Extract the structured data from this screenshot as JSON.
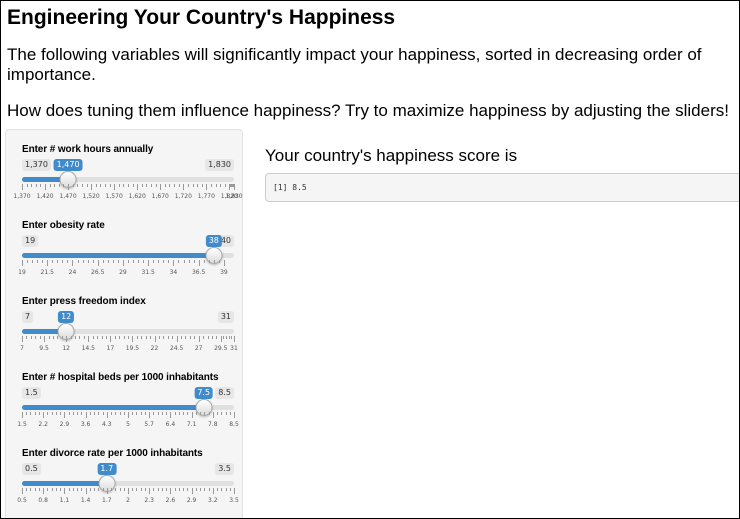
{
  "header": {
    "title": "Engineering Your Country's Happiness",
    "intro": "The following variables will significantly impact your happiness, sorted in decreasing order of importance.",
    "question": "How does tuning them influence happiness? Try to maximize happiness by adjusting the sliders!"
  },
  "sliders": [
    {
      "label": "Enter # work hours annually",
      "min": 1370,
      "max": 1830,
      "value": 1470,
      "min_label": "1,370",
      "max_label": "1,830",
      "value_label": "1,470",
      "ticks": [
        1370,
        1420,
        1470,
        1520,
        1570,
        1620,
        1670,
        1720,
        1770,
        1820,
        1830
      ],
      "tick_labels": [
        "1,370",
        "1,420",
        "1,470",
        "1,520",
        "1,570",
        "1,620",
        "1,670",
        "1,720",
        "1,770",
        "1,820",
        "1,830"
      ]
    },
    {
      "label": "Enter obesity rate",
      "min": 19,
      "max": 40,
      "value": 38,
      "min_label": "19",
      "max_label": "40",
      "value_label": "38",
      "ticks": [
        19,
        21.5,
        24,
        26.5,
        29,
        31.5,
        34,
        36.5,
        39
      ],
      "tick_labels": [
        "19",
        "21.5",
        "24",
        "26.5",
        "29",
        "31.5",
        "34",
        "36.5",
        "39"
      ]
    },
    {
      "label": "Enter press freedom index",
      "min": 7,
      "max": 31,
      "value": 12,
      "min_label": "7",
      "max_label": "31",
      "value_label": "12",
      "ticks": [
        7,
        9.5,
        12,
        14.5,
        17,
        19.5,
        22,
        24.5,
        27,
        29.5,
        31
      ],
      "tick_labels": [
        "7",
        "9.5",
        "12",
        "14.5",
        "17",
        "19.5",
        "22",
        "24.5",
        "27",
        "29.5",
        "31"
      ]
    },
    {
      "label": "Enter # hospital beds per 1000 inhabitants",
      "min": 1.5,
      "max": 8.5,
      "value": 7.5,
      "min_label": "1.5",
      "max_label": "8.5",
      "value_label": "7.5",
      "ticks": [
        1.5,
        2.2,
        2.9,
        3.6,
        4.3,
        5,
        5.7,
        6.4,
        7.1,
        7.8,
        8.5
      ],
      "tick_labels": [
        "1.5",
        "2.2",
        "2.9",
        "3.6",
        "4.3",
        "5",
        "5.7",
        "6.4",
        "7.1",
        "7.8",
        "8.5"
      ]
    },
    {
      "label": "Enter divorce rate per 1000 inhabitants",
      "min": 0.5,
      "max": 3.5,
      "value": 1.7,
      "min_label": "0.5",
      "max_label": "3.5",
      "value_label": "1.7",
      "ticks": [
        0.5,
        0.8,
        1.1,
        1.4,
        1.7,
        2,
        2.3,
        2.6,
        2.9,
        3.2,
        3.5
      ],
      "tick_labels": [
        "0.5",
        "0.8",
        "1.1",
        "1.4",
        "1.7",
        "2",
        "2.3",
        "2.6",
        "2.9",
        "3.2",
        "3.5"
      ]
    }
  ],
  "result": {
    "label": "Your country's happiness score is",
    "output": "[1] 8.5"
  },
  "colors": {
    "accent": "#428bca",
    "sidebar_bg": "#f5f5f5"
  }
}
